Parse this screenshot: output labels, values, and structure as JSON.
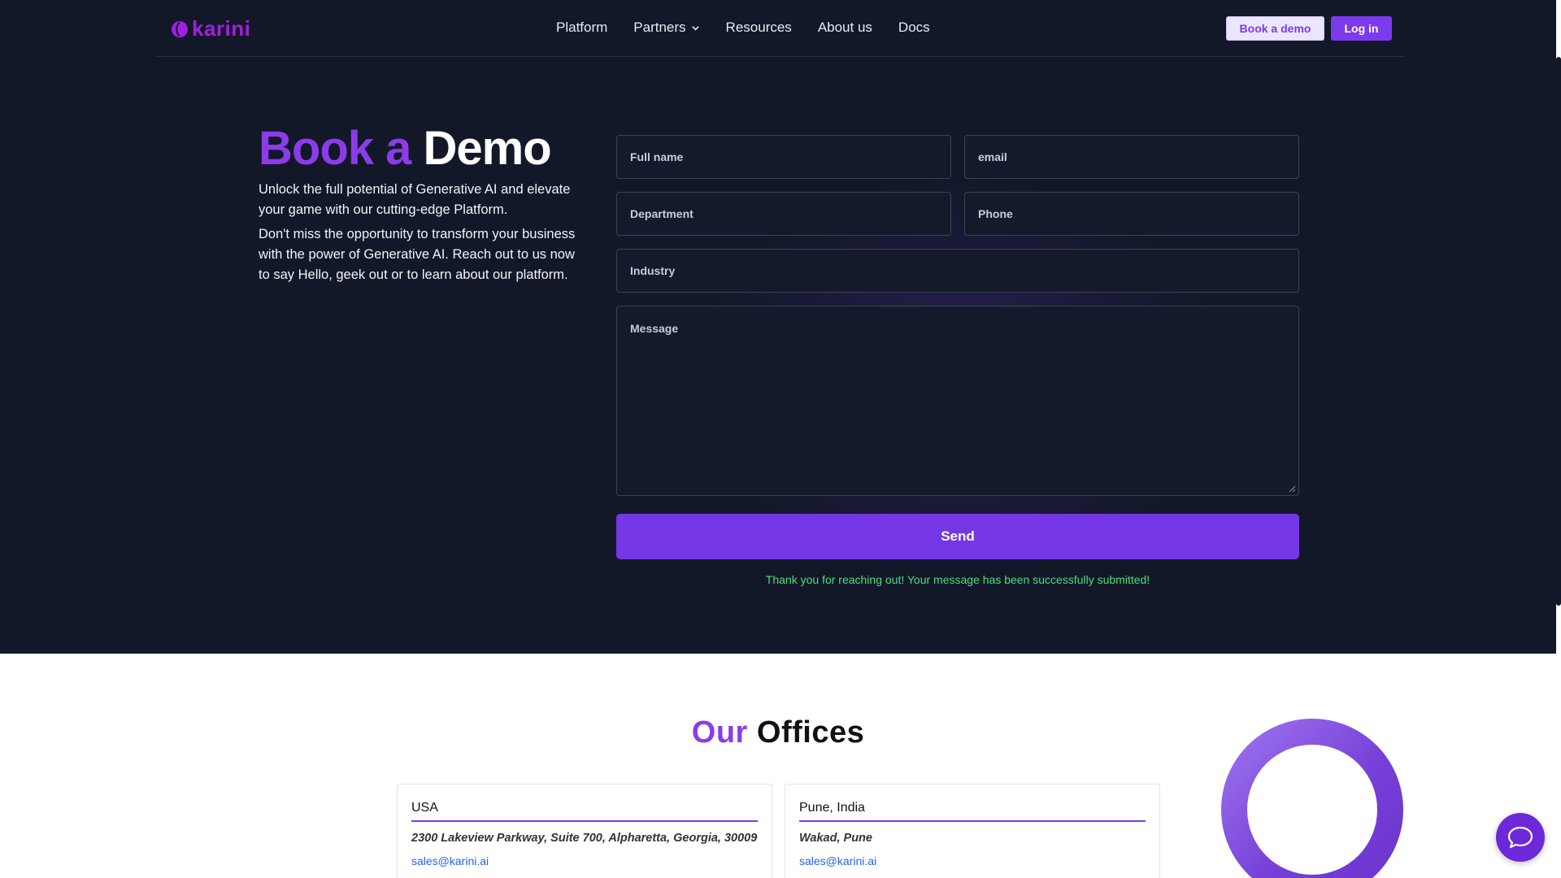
{
  "brand": {
    "name": "karini",
    "color": "#a21fe0",
    "accent": "#7c3aed"
  },
  "nav": {
    "items": [
      {
        "label": "Platform"
      },
      {
        "label": "Partners",
        "dropdown": true
      },
      {
        "label": "Resources"
      },
      {
        "label": "About us"
      },
      {
        "label": "Docs"
      }
    ],
    "book_demo": "Book a demo",
    "login": "Log in"
  },
  "hero": {
    "title_accent": "Book a",
    "title_rest": "Demo",
    "p1": "Unlock the full potential of Generative AI and elevate your game with our cutting-edge Platform.",
    "p2": "Don't miss the opportunity to transform your business with the power of Generative AI. Reach out to us now to say Hello, geek out or to learn about our platform."
  },
  "form": {
    "full_name": "Full name",
    "email": "email",
    "department": "Department",
    "phone": "Phone",
    "industry": "Industry",
    "message": "Message",
    "send": "Send",
    "success": "Thank you for reaching out! Your message has been successfully submitted!"
  },
  "offices": {
    "title_accent": "Our",
    "title_rest": "Offices",
    "cards": [
      {
        "name": "USA",
        "address": "2300 Lakeview Parkway, Suite 700, Alpharetta, Georgia, 30009",
        "email": "sales@karini.ai"
      },
      {
        "name": "Pune, India",
        "address": "Wakad, Pune",
        "email": "sales@karini.ai"
      }
    ]
  },
  "icons": {
    "logo": "karini-logo-icon",
    "dropdown": "chevron-down-icon",
    "chat": "chat-bubble-icon"
  }
}
